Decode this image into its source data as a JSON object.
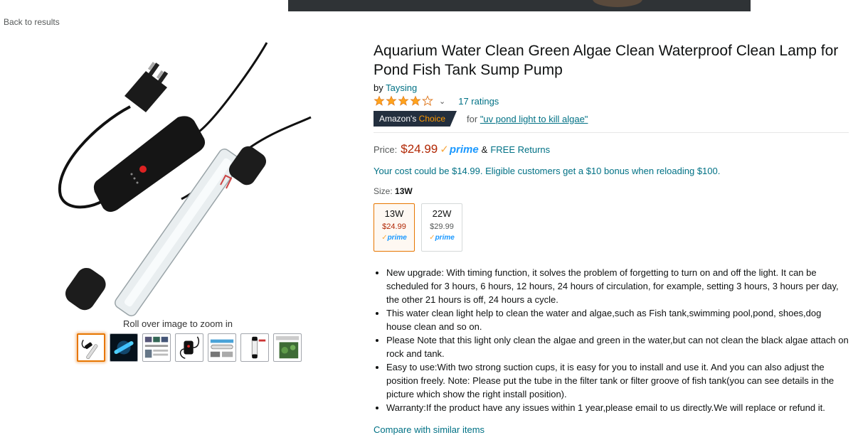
{
  "nav": {
    "back_label": "Back to results"
  },
  "gallery": {
    "zoom_hint": "Roll over image to zoom in",
    "thumbnails": [
      "thumb-1",
      "thumb-2",
      "thumb-3",
      "thumb-4",
      "thumb-5",
      "thumb-6",
      "thumb-7"
    ],
    "selected_index": 0
  },
  "product": {
    "title": "Aquarium Water Clean Green Algae Clean Waterproof Clean Lamp for Pond Fish Tank Sump Pump",
    "by_prefix": "by",
    "brand": "Taysing",
    "rating": 4,
    "ratings_count": "17 ratings",
    "badge_prefix": "Amazon's",
    "badge_choice": "Choice",
    "choice_for_prefix": "for",
    "choice_query": "\"uv pond light to kill algae\"",
    "price_label": "Price:",
    "price": "$24.99",
    "prime_label": "prime",
    "returns_prefix": "&",
    "returns_label": "FREE Returns",
    "bonus_text": "Your cost could be $14.99. Eligible customers get a $10 bonus when reloading $100.",
    "size_label": "Size:",
    "size_selected": "13W",
    "variants": [
      {
        "name": "13W",
        "price": "$24.99",
        "prime": "prime"
      },
      {
        "name": "22W",
        "price": "$29.99",
        "prime": "prime"
      }
    ],
    "bullets": [
      "New upgrade: With timing function, it solves the problem of forgetting to turn on and off the light. It can be scheduled for 3 hours, 6 hours, 12 hours, 24 hours of circulation, for example, setting 3 hours, 3 hours per day, the other 21 hours is off, 24 hours a cycle.",
      "This water clean light help to clean the water and algae,such as Fish tank,swimming pool,pond, shoes,dog house clean and so on.",
      "Please Note that this light only clean the algae and green in the water,but can not clean the black algae attach on rock and tank.",
      "Easy to use:With two strong suction cups, it is easy for you to install and use it. And you can also adjust the position freely. Note: Please put the tube in the filter tank or filter groove of fish tank(you can see details in the picture which show the right install position).",
      "Warranty:If the product have any issues within 1 year,please email to us directly.We will replace or refund it."
    ],
    "compare_label": "Compare with similar items"
  },
  "colors": {
    "price": "#B12704",
    "link": "#007185",
    "prime": "#1A98FF",
    "badge_bg": "#232F3E",
    "badge_choice": "#FF9900",
    "selected_border": "#e77600"
  }
}
